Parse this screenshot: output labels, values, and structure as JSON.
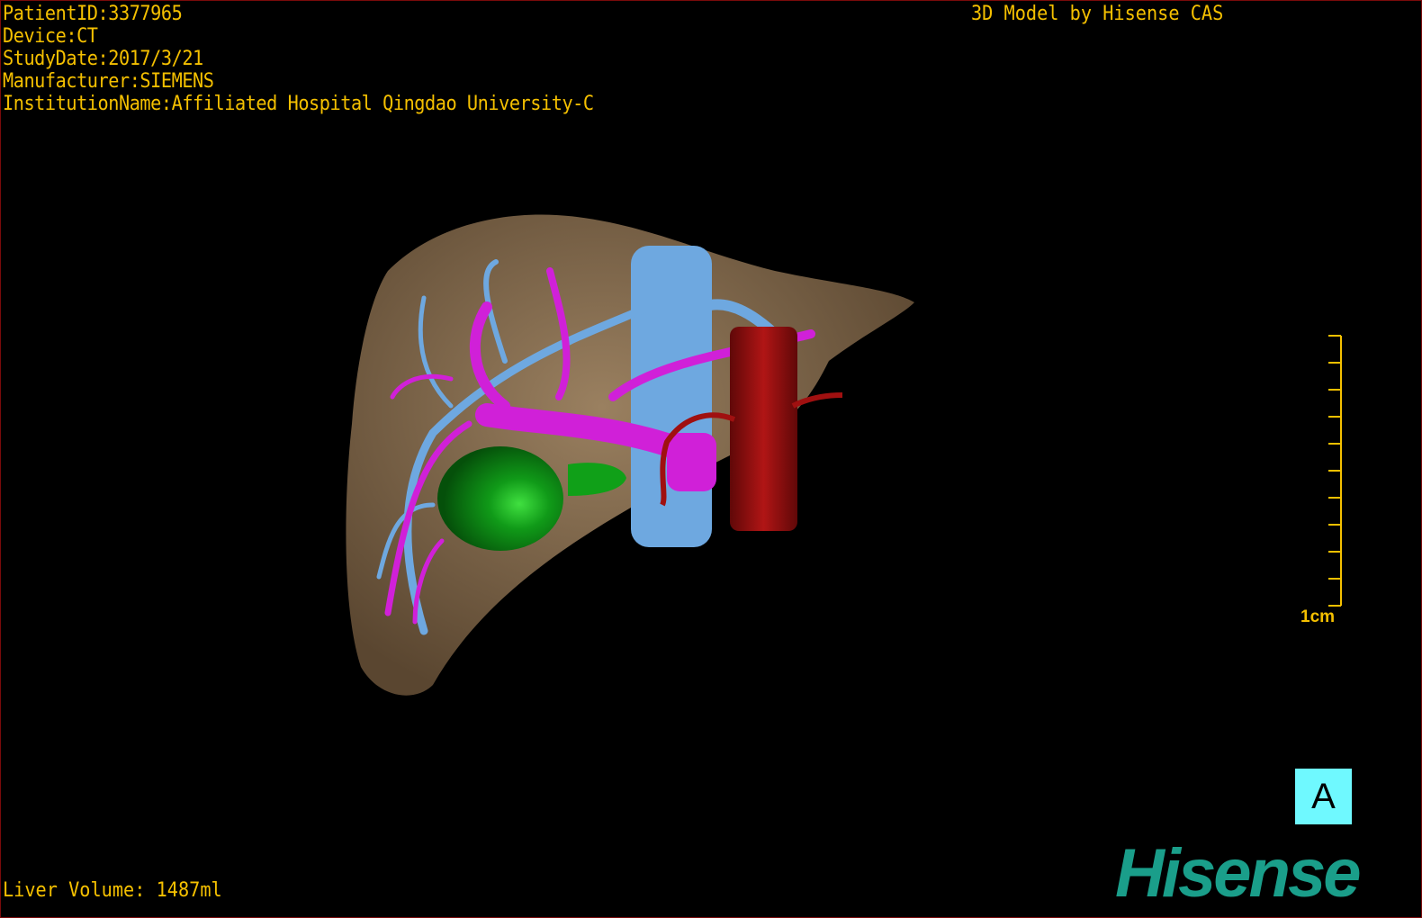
{
  "info": {
    "patient_id": "PatientID:3377965",
    "device": "Device:CT",
    "study_date": "StudyDate:2017/3/21",
    "manufacturer": "Manufacturer:SIEMENS",
    "institution": "InstitutionName:Affiliated Hospital Qingdao University-C"
  },
  "model_credit": "3D Model by Hisense CAS",
  "liver_volume": "Liver Volume: 1487ml",
  "scale_bar": {
    "label": "1cm",
    "ticks": 10
  },
  "orientation_label": "A",
  "logo_text": "Hisense",
  "colors": {
    "text": "#f5c000",
    "liver": "#8a7050",
    "portal_vein": "#d020d8",
    "hepatic_vein": "#6ea8e0",
    "artery": "#a01010",
    "gallbladder": "#10a018",
    "orientation_box": "#6ff9ff",
    "logo": "#1a9e8a"
  }
}
